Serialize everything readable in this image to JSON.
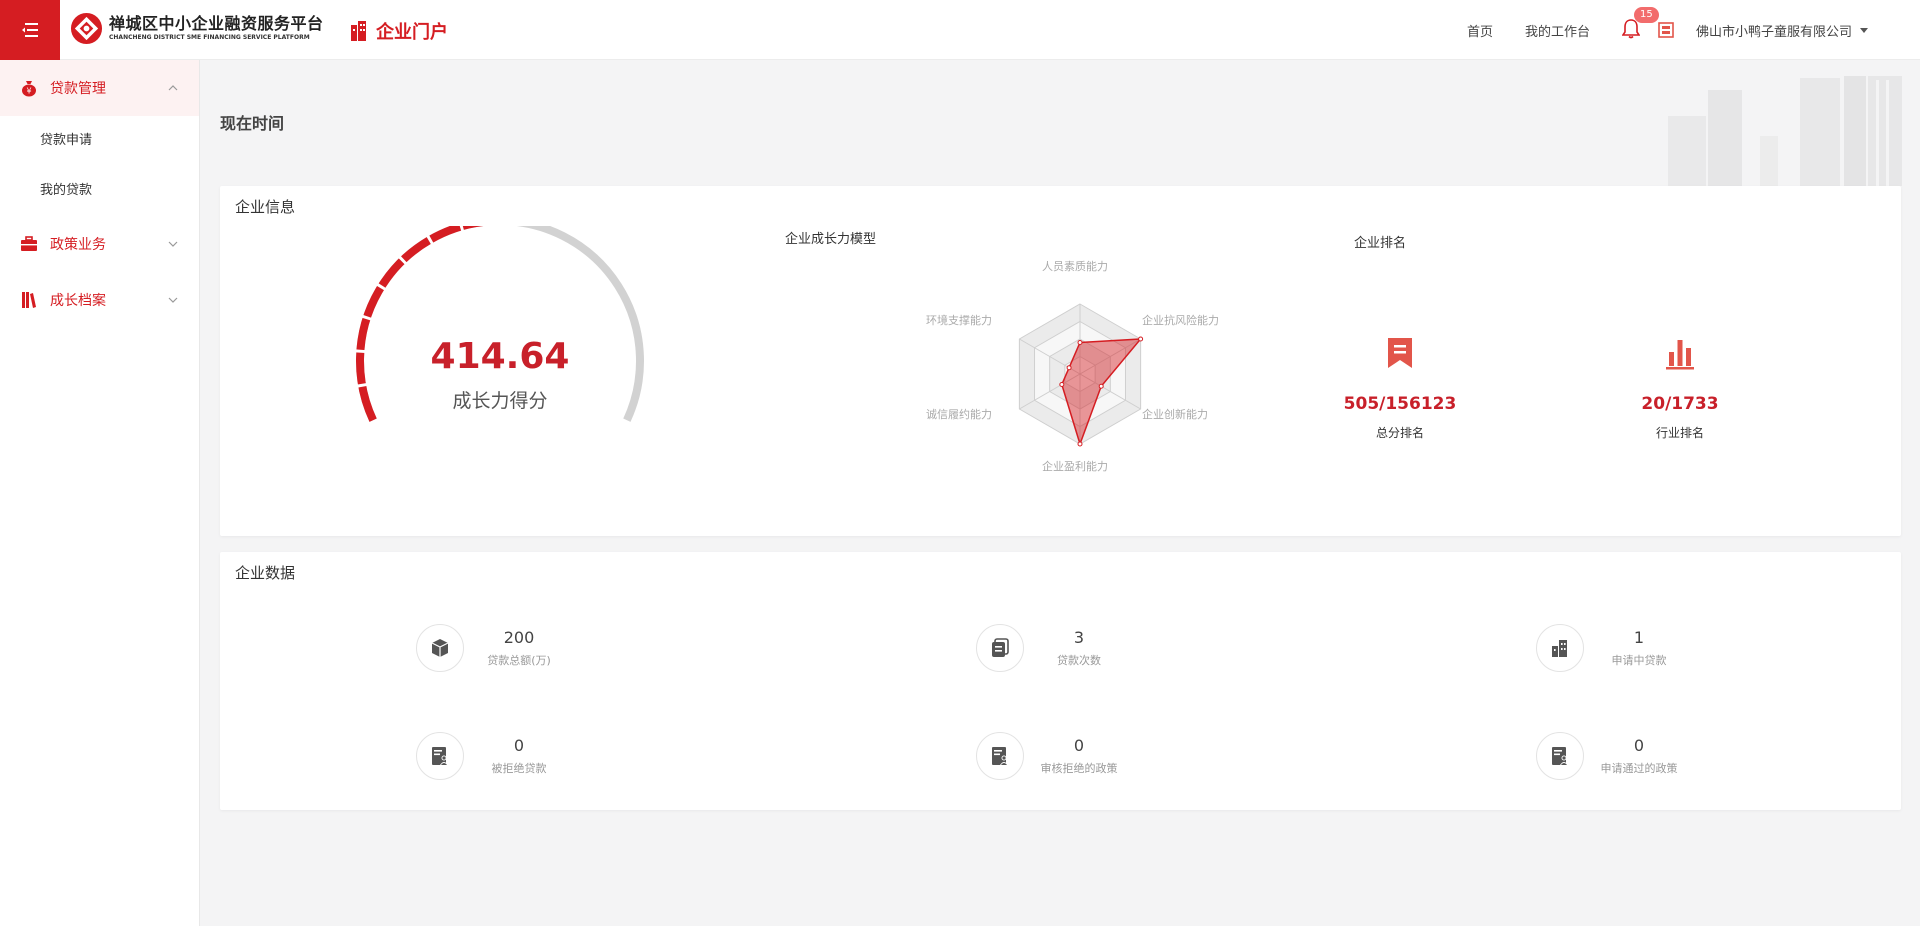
{
  "header": {
    "brand_cn": "禅城区中小企业融资服务平台",
    "brand_en": "CHANCHENG DISTRICT SME FINANCING SERVICE PLATFORM",
    "portal": "企业门户",
    "nav_home": "首页",
    "nav_workbench": "我的工作台",
    "notification_count": "15",
    "company": "佛山市小鸭子童服有限公司"
  },
  "sidebar": {
    "items": [
      {
        "label": "贷款管理",
        "icon": "money-bag-icon",
        "expanded": true,
        "children": [
          {
            "label": "贷款申请"
          },
          {
            "label": "我的贷款"
          }
        ]
      },
      {
        "label": "政策业务",
        "icon": "briefcase-icon",
        "expanded": false
      },
      {
        "label": "成长档案",
        "icon": "archive-icon",
        "expanded": false
      }
    ]
  },
  "main": {
    "now_title": "现在时间",
    "info": {
      "title": "企业信息",
      "score_value": "414.64",
      "score_label": "成长力得分",
      "radar_title": "企业成长力模型",
      "radar_axes": [
        "人员素质能力",
        "企业抗风险能力",
        "企业创新能力",
        "企业盈利能力",
        "诚信履约能力",
        "环境支撑能力"
      ],
      "ranking_title": "企业排名",
      "rank_total_value": "505/156123",
      "rank_total_label": "总分排名",
      "rank_industry_value": "20/1733",
      "rank_industry_label": "行业排名"
    },
    "data": {
      "title": "企业数据",
      "stats": [
        {
          "value": "200",
          "label": "贷款总额(万)",
          "icon": "cube-icon"
        },
        {
          "value": "3",
          "label": "贷款次数",
          "icon": "documents-icon"
        },
        {
          "value": "1",
          "label": "申请中贷款",
          "icon": "building-icon"
        },
        {
          "value": "0",
          "label": "被拒绝贷款",
          "icon": "id-card-icon"
        },
        {
          "value": "0",
          "label": "审核拒绝的政策",
          "icon": "id-card-icon"
        },
        {
          "value": "0",
          "label": "申请通过的政策",
          "icon": "id-card-icon"
        }
      ]
    }
  },
  "colors": {
    "brand_red": "#d51d22",
    "value_red": "#c8202a"
  }
}
